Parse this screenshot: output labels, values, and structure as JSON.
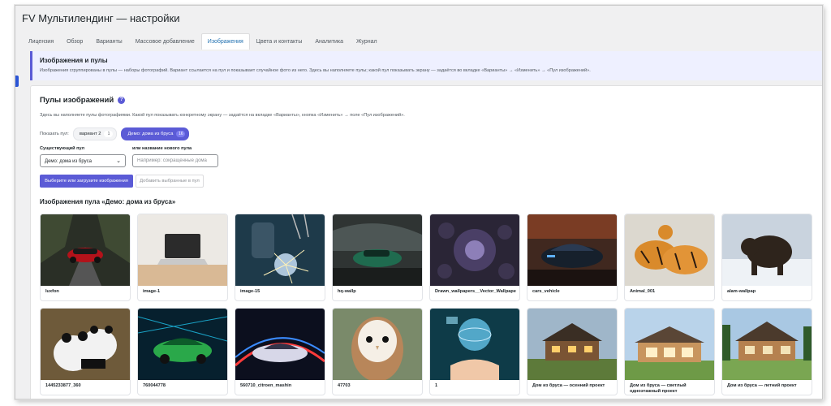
{
  "header": {
    "title": "FV Мультилендинг — настройки"
  },
  "tabs": [
    {
      "label": "Лицензия",
      "active": false
    },
    {
      "label": "Обзор",
      "active": false
    },
    {
      "label": "Варианты",
      "active": false
    },
    {
      "label": "Массовое добавление",
      "active": false
    },
    {
      "label": "Изображения",
      "active": true
    },
    {
      "label": "Цвета и контакты",
      "active": false
    },
    {
      "label": "Аналитика",
      "active": false
    },
    {
      "label": "Журнал",
      "active": false
    }
  ],
  "notice": {
    "title": "Изображения и пулы",
    "text": "Изображения сгруппированы в пулы — наборы фотографий. Вариант ссылается на пул и показывает случайное фото из него. Здесь вы наполняете пулы; какой пул показывать экрану — задаётся во вкладке «Варианты» → «Изменить» → «Пул изображений»."
  },
  "pools": {
    "title": "Пулы изображений",
    "help": "?",
    "description": "Здесь вы наполняете пулы фотографиями. Какой пул показывать конкретному экрану — задаётся на вкладке «Варианты», кнопка «Изменить» → поле «Пул изображений».",
    "show_label": "Показать пул:",
    "pills": [
      {
        "label": "вариант 2",
        "count": "1",
        "active": false
      },
      {
        "label": "Демо: дома из бруса",
        "count": "16",
        "active": true
      }
    ],
    "existing_label": "Существующий пул",
    "existing_value": "Демо: дома из бруса",
    "new_label": "или название нового пула",
    "new_placeholder": "Например: сокращенные дома",
    "upload_button": "Выберите или загрузите изображения",
    "add_button": "Добавить выбранные в пул",
    "grid_title": "Изображения пула «Демо: дома из бруса»"
  },
  "images": [
    {
      "caption": "luxfon",
      "icon": "red-car-image"
    },
    {
      "caption": "image-1",
      "icon": "laptop-image"
    },
    {
      "caption": "image-15",
      "icon": "welding-image"
    },
    {
      "caption": "hq-wallp",
      "icon": "green-car-image"
    },
    {
      "caption": "Drawn_wallpapers__Vector_Wallpapers_",
      "icon": "pattern-image"
    },
    {
      "caption": "cars_vehicle",
      "icon": "dark-car-image"
    },
    {
      "caption": "Animal_001",
      "icon": "tigers-image"
    },
    {
      "caption": "alam-wallpap",
      "icon": "bear-image"
    },
    {
      "caption": "1445233877_360",
      "icon": "pandas-image"
    },
    {
      "caption": "760044778",
      "icon": "neon-car-image"
    },
    {
      "caption": "560710_citroen_mashin",
      "icon": "sport-car-image"
    },
    {
      "caption": "47703",
      "icon": "owl-image"
    },
    {
      "caption": "1",
      "icon": "globe-hand-image"
    },
    {
      "caption": "Дом из бруса — осенний проект",
      "icon": "house-autumn-image"
    },
    {
      "caption": "Дом из бруса — светлый одноэтажный проект",
      "icon": "house-light-image"
    },
    {
      "caption": "Дом из бруса — летний проект",
      "icon": "house-summer-image"
    }
  ]
}
